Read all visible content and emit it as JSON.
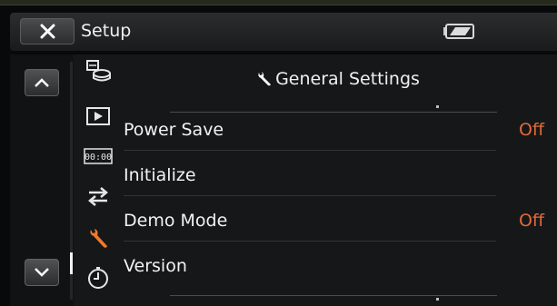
{
  "header": {
    "title": "Setup",
    "close_icon": "close-icon",
    "battery_icon": "battery-icon"
  },
  "nav": {
    "up_icon": "chevron-up-icon",
    "down_icon": "chevron-down-icon"
  },
  "categories": [
    {
      "name": "card-settings-icon",
      "active": false
    },
    {
      "name": "playback-icon",
      "active": false
    },
    {
      "name": "timecode-icon",
      "label": "00:00",
      "active": false
    },
    {
      "name": "connection-icon",
      "active": false
    },
    {
      "name": "wrench-icon",
      "active": true
    },
    {
      "name": "clock-icon",
      "active": false
    }
  ],
  "section": {
    "title": "General Settings",
    "icon": "wrench-icon"
  },
  "items": [
    {
      "label": "Power Save",
      "value": "Off"
    },
    {
      "label": "Initialize",
      "value": ""
    },
    {
      "label": "Demo Mode",
      "value": "Off"
    },
    {
      "label": "Version",
      "value": ""
    }
  ],
  "colors": {
    "accent": "#e06a3a",
    "active_icon": "#f07a2a",
    "text": "#f0f0f0"
  }
}
